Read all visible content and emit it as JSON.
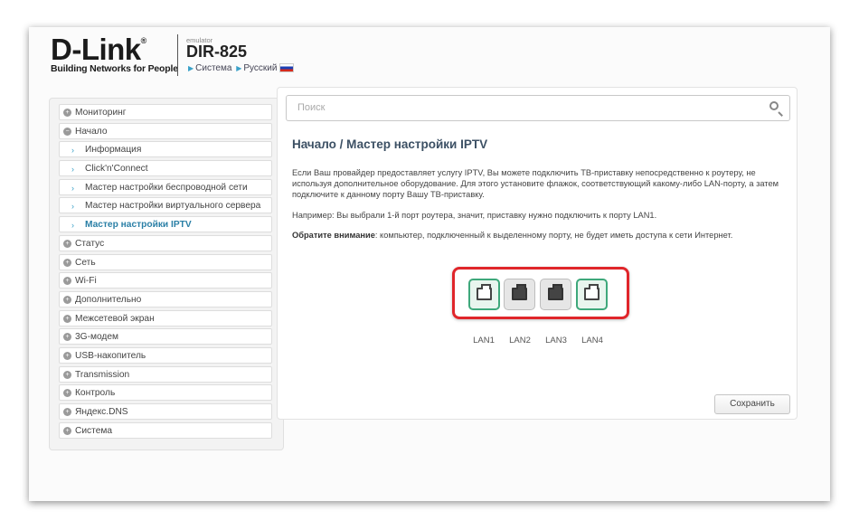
{
  "header": {
    "logo_text": "D-Link",
    "logo_reg": "®",
    "tagline": "Building Networks for People",
    "emulator_label": "emulator",
    "model": "DIR-825",
    "breadcrumb_system": "Система",
    "breadcrumb_language": "Русский",
    "flag_icon": "russia-flag-icon"
  },
  "sidebar": {
    "items": [
      {
        "label": "Мониторинг",
        "icon": "expand-plus-icon"
      },
      {
        "label": "Начало",
        "icon": "collapse-minus-icon"
      },
      {
        "label": "Информация",
        "icon": "chevron-right-icon"
      },
      {
        "label": "Click'n'Connect",
        "icon": "chevron-right-icon"
      },
      {
        "label": "Мастер настройки беспроводной сети",
        "icon": "chevron-right-icon"
      },
      {
        "label": "Мастер настройки виртуального сервера",
        "icon": "chevron-right-icon"
      },
      {
        "label": "Мастер настройки IPTV",
        "icon": "chevron-right-icon"
      },
      {
        "label": "Статус",
        "icon": "expand-plus-icon"
      },
      {
        "label": "Сеть",
        "icon": "expand-plus-icon"
      },
      {
        "label": "Wi-Fi",
        "icon": "expand-plus-icon"
      },
      {
        "label": "Дополнительно",
        "icon": "expand-plus-icon"
      },
      {
        "label": "Межсетевой экран",
        "icon": "expand-plus-icon"
      },
      {
        "label": "3G-модем",
        "icon": "expand-plus-icon"
      },
      {
        "label": "USB-накопитель",
        "icon": "expand-plus-icon"
      },
      {
        "label": "Transmission",
        "icon": "expand-plus-icon"
      },
      {
        "label": "Контроль",
        "icon": "expand-plus-icon"
      },
      {
        "label": "Яндекс.DNS",
        "icon": "expand-plus-icon"
      },
      {
        "label": "Система",
        "icon": "expand-plus-icon"
      }
    ]
  },
  "search": {
    "placeholder": "Поиск",
    "icon": "search-icon"
  },
  "main": {
    "title": "Начало /  Мастер настройки IPTV",
    "paragraph1": "Если Ваш провайдер предоставляет услугу IPTV, Вы можете подключить ТВ-приставку непосредственно к роутеру, не используя дополнительное оборудование. Для этого установите флажок, соответствующий какому-либо LAN-порту, а затем подключите к данному порту Вашу ТВ-приставку.",
    "paragraph2": "Например: Вы выбрали 1-й порт роутера, значит, приставку нужно подключить к порту LAN1.",
    "notice_label": "Обратите внимание",
    "notice_text": ": компьютер, подключенный к выделенному порту, не будет иметь доступа к сети Интернет.",
    "ports": [
      {
        "label": "LAN1",
        "selected": true
      },
      {
        "label": "LAN2",
        "selected": false
      },
      {
        "label": "LAN3",
        "selected": false
      },
      {
        "label": "LAN4",
        "selected": true
      }
    ],
    "save_label": "Сохранить"
  },
  "colors": {
    "accent": "#2a7fa6",
    "highlight_frame": "#e0262b",
    "port_selected": "#3ea87b"
  }
}
